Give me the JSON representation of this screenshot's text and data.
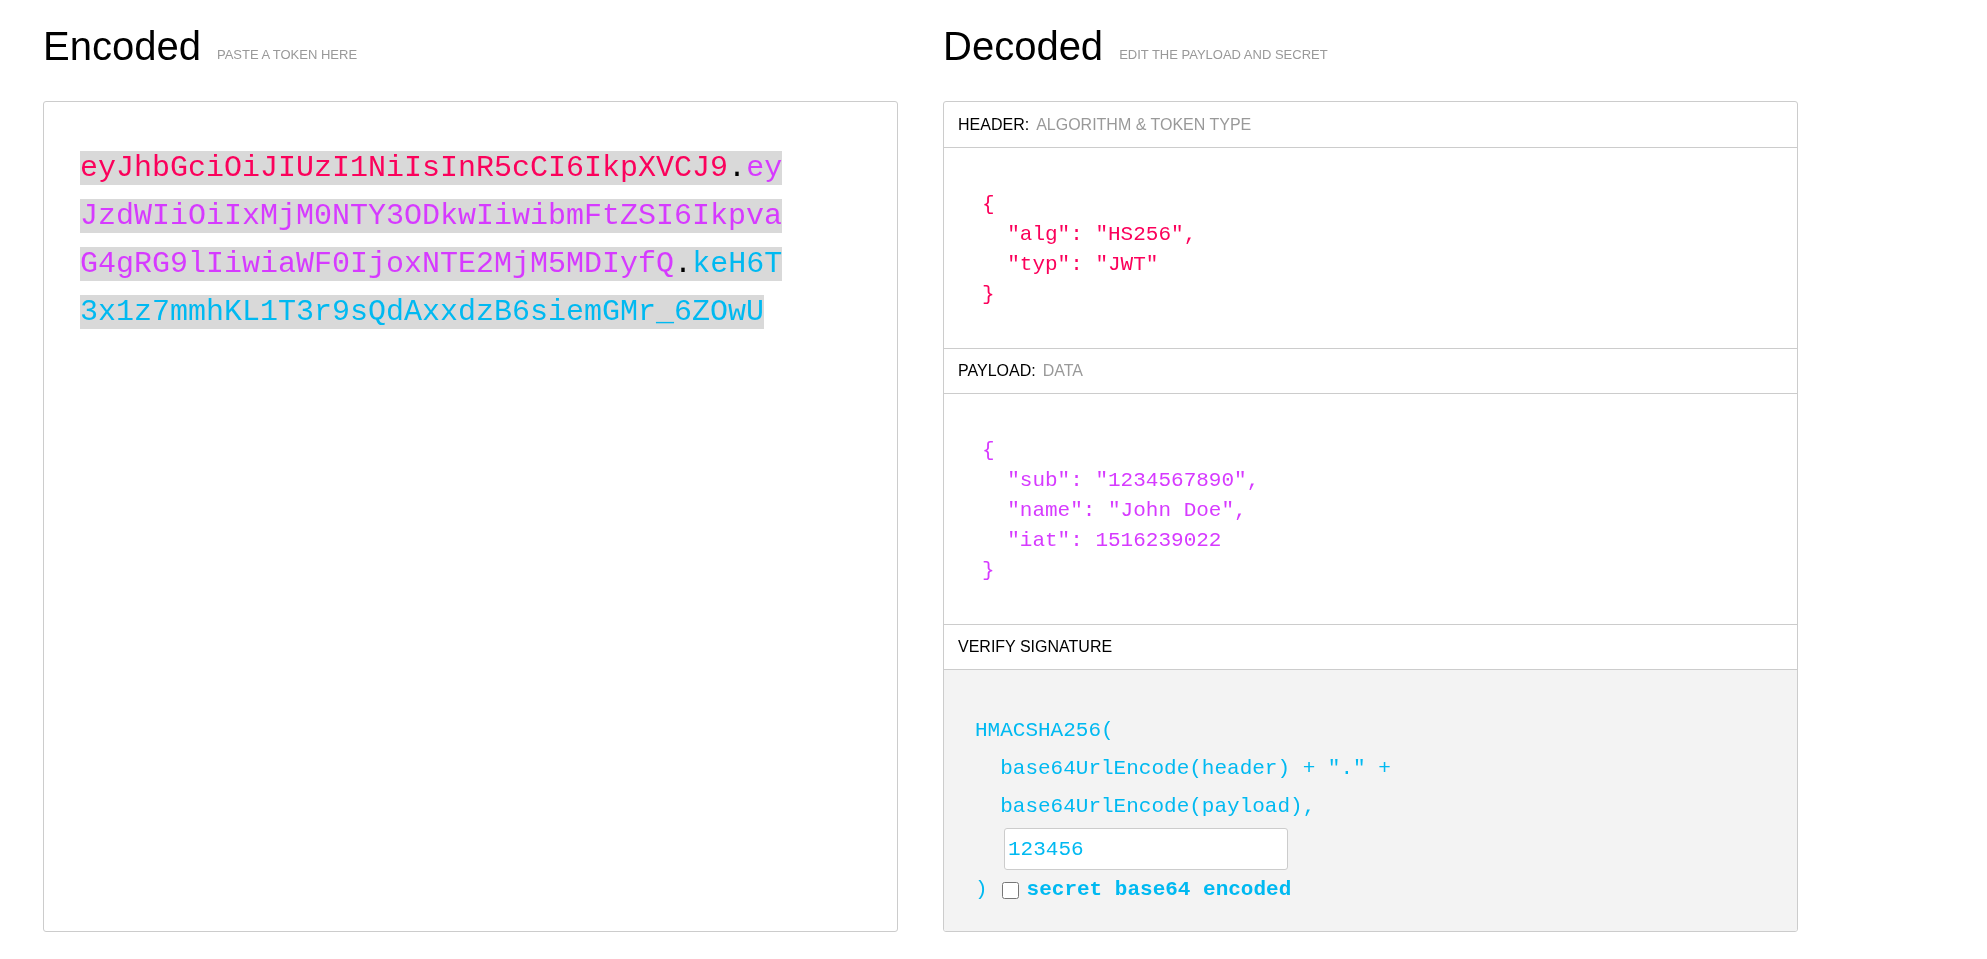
{
  "encoded": {
    "title": "Encoded",
    "hint": "PASTE A TOKEN HERE",
    "token": [
      {
        "text": "eyJhbGciOiJIUzI1NiIsInR5cCI6IkpXVCJ9",
        "color": "#fb015b"
      },
      {
        "text": ".",
        "color": "#000000"
      },
      {
        "text": "eyJzdWIiOiIxMjM0NTY3ODkwIiwibmFtZSI6IkpvaG4gRG9lIiwiaWF0IjoxNTE2MjM5MDIyfQ",
        "color": "#d63aff"
      },
      {
        "text": ".",
        "color": "#000000"
      },
      {
        "text": "keH6T3x1z7mmhKL1T3r9sQdAxxdzB6siemGMr_6ZOwU",
        "color": "#00b9f1"
      }
    ]
  },
  "decoded": {
    "title": "Decoded",
    "hint": "EDIT THE PAYLOAD AND SECRET",
    "sections": [
      {
        "kind": "json",
        "label": "HEADER:",
        "hint": "ALGORITHM & TOKEN TYPE",
        "color": "#fb015b",
        "lines": [
          "{",
          "  \"alg\": \"HS256\",",
          "  \"typ\": \"JWT\"",
          "}"
        ]
      },
      {
        "kind": "json",
        "label": "PAYLOAD:",
        "hint": "DATA",
        "color": "#d63aff",
        "lines": [
          "{",
          "  \"sub\": \"1234567890\",",
          "  \"name\": \"John Doe\",",
          "  \"iat\": 1516239022",
          "}"
        ]
      },
      {
        "kind": "signature",
        "label": "VERIFY SIGNATURE",
        "color": "#00b9f1",
        "lines": [
          "HMACSHA256(",
          "  base64UrlEncode(header) + \".\" +",
          "  base64UrlEncode(payload),"
        ],
        "secret": "123456",
        "close": ")",
        "checkbox": {
          "label": "secret base64 encoded",
          "checked": false
        }
      }
    ]
  }
}
